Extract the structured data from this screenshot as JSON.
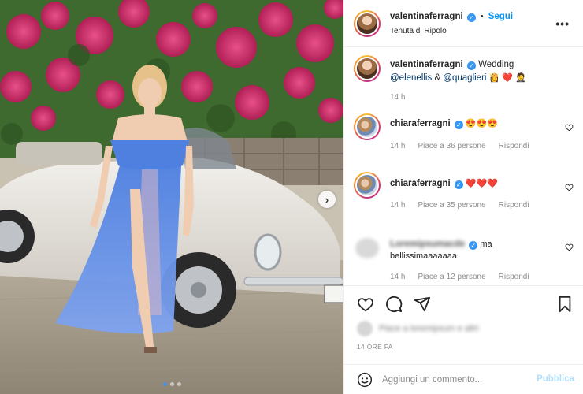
{
  "post": {
    "author": "valentinaferragni",
    "location": "Tenuta di Ripolo",
    "follow_label": "Segui",
    "more_label": "•••",
    "caption": {
      "text": "Wedding",
      "mention1": "@elenellis",
      "amp": "&",
      "mention2": "@quaglieri",
      "emojis": "👸 ❤️ 🤵",
      "time": "14 h"
    }
  },
  "comments": [
    {
      "user": "chiaraferragni",
      "text": "😍😍😍",
      "time": "14 h",
      "likes": "Piace a 36 persone",
      "reply": "Rispondi"
    },
    {
      "user": "chiaraferragni",
      "text": "❤️❤️❤️",
      "time": "14 h",
      "likes": "Piace a 35 persone",
      "reply": "Rispondi"
    },
    {
      "user": "Loremipsumacde",
      "text": "ma bellissimaaaaaaa",
      "time": "14 h",
      "likes": "Piace a 12 persone",
      "reply": "Rispondi"
    }
  ],
  "footer": {
    "likes_blurred": "Piace a loremipsum e altri",
    "timestamp": "14 ORE FA",
    "comment_placeholder": "Aggiungi un commento...",
    "publish_label": "Pubblica"
  },
  "carousel": {
    "slides": 3,
    "active": 1,
    "next_icon": "chevron-right-icon"
  },
  "colors": {
    "accent": "#0095f6",
    "verified": "#3897f0",
    "heart": "#ed4956",
    "publish_disabled": "#b2dffc"
  }
}
